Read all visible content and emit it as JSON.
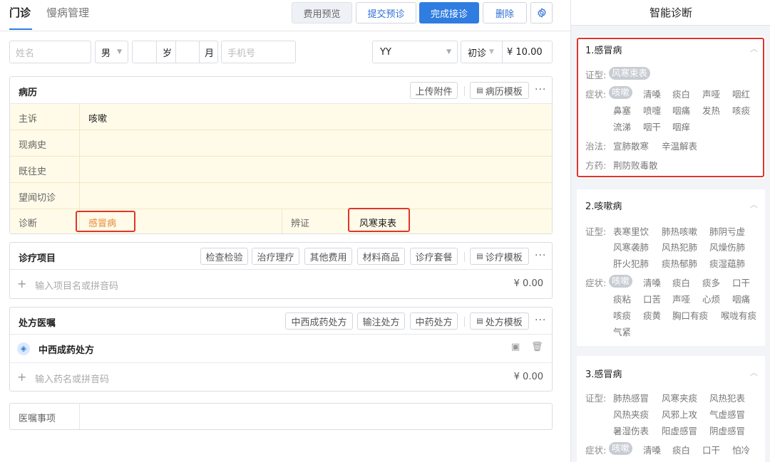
{
  "tabs": [
    "门诊",
    "慢病管理"
  ],
  "toolbar": {
    "preview": "费用预览",
    "submit": "提交预诊",
    "complete": "完成接诊",
    "delete": "删除"
  },
  "patient": {
    "name_placeholder": "姓名",
    "gender": "男",
    "age_unit_year": "岁",
    "age_unit_month": "月",
    "phone_placeholder": "手机号",
    "type": "YY",
    "visit": "初诊",
    "fee": "¥ 10.00"
  },
  "record": {
    "title": "病历",
    "upload": "上传附件",
    "template": "病历模板",
    "rows": [
      {
        "label": "主诉",
        "value": "咳嗽"
      },
      {
        "label": "现病史",
        "value": ""
      },
      {
        "label": "既往史",
        "value": ""
      },
      {
        "label": "望闻切诊",
        "value": ""
      }
    ],
    "diagnosis_label": "诊断",
    "diagnosis_value": "感冒病",
    "syndrome_label": "辨证",
    "syndrome_value": "风寒束表"
  },
  "treatment": {
    "title": "诊疗项目",
    "buttons": [
      "检查检验",
      "治疗理疗",
      "其他费用",
      "材料商品",
      "诊疗套餐"
    ],
    "template": "诊疗模板",
    "input_placeholder": "输入项目名或拼音码",
    "price": "¥ 0.00"
  },
  "prescription": {
    "title": "处方医嘱",
    "buttons": [
      "中西成药处方",
      "输注处方",
      "中药处方"
    ],
    "template": "处方模板",
    "sub_title": "中西成药处方",
    "input_placeholder": "输入药名或拼音码",
    "price": "¥ 0.00"
  },
  "advice": {
    "label": "医嘱事项"
  },
  "smart": {
    "title": "智能诊断",
    "cards": [
      {
        "title": "1.感冒病",
        "syndrome_label": "证型:",
        "syndromes": [
          "风寒束表"
        ],
        "symptom_label": "症状:",
        "symptoms": [
          "咳嗽",
          "清嗓",
          "痰白",
          "声哑",
          "咽红",
          "鼻塞",
          "喷嚏",
          "咽痛",
          "发热",
          "咳痰",
          "流涕",
          "咽干",
          "咽痒"
        ],
        "therapy_label": "治法:",
        "therapies": [
          "宣肺散寒",
          "辛温解表"
        ],
        "formula_label": "方药:",
        "formulas": [
          "荆防败毒散"
        ]
      },
      {
        "title": "2.咳嗽病",
        "syndrome_label": "证型:",
        "syndromes": [
          "表寒里饮",
          "肺热咳嗽",
          "肺阴亏虚",
          "风寒袭肺",
          "风热犯肺",
          "风燥伤肺",
          "肝火犯肺",
          "痰热郁肺",
          "痰湿蕴肺"
        ],
        "symptom_label": "症状:",
        "symptoms": [
          "咳嗽",
          "清嗓",
          "痰白",
          "痰多",
          "口干",
          "痰粘",
          "口苦",
          "声哑",
          "心烦",
          "咽痛",
          "咳痰",
          "痰黄",
          "胸口有痰",
          "喉咙有痰",
          "气紧"
        ]
      },
      {
        "title": "3.感冒病",
        "syndrome_label": "证型:",
        "syndromes": [
          "肺热感冒",
          "风寒夹痰",
          "风热犯表",
          "风热夹痰",
          "风邪上攻",
          "气虚感冒",
          "暑湿伤表",
          "阳虚感冒",
          "阴虚感冒"
        ],
        "symptom_label": "症状:",
        "symptoms": [
          "咳嗽",
          "清嗓",
          "痰白",
          "口干",
          "怕冷"
        ]
      }
    ]
  }
}
